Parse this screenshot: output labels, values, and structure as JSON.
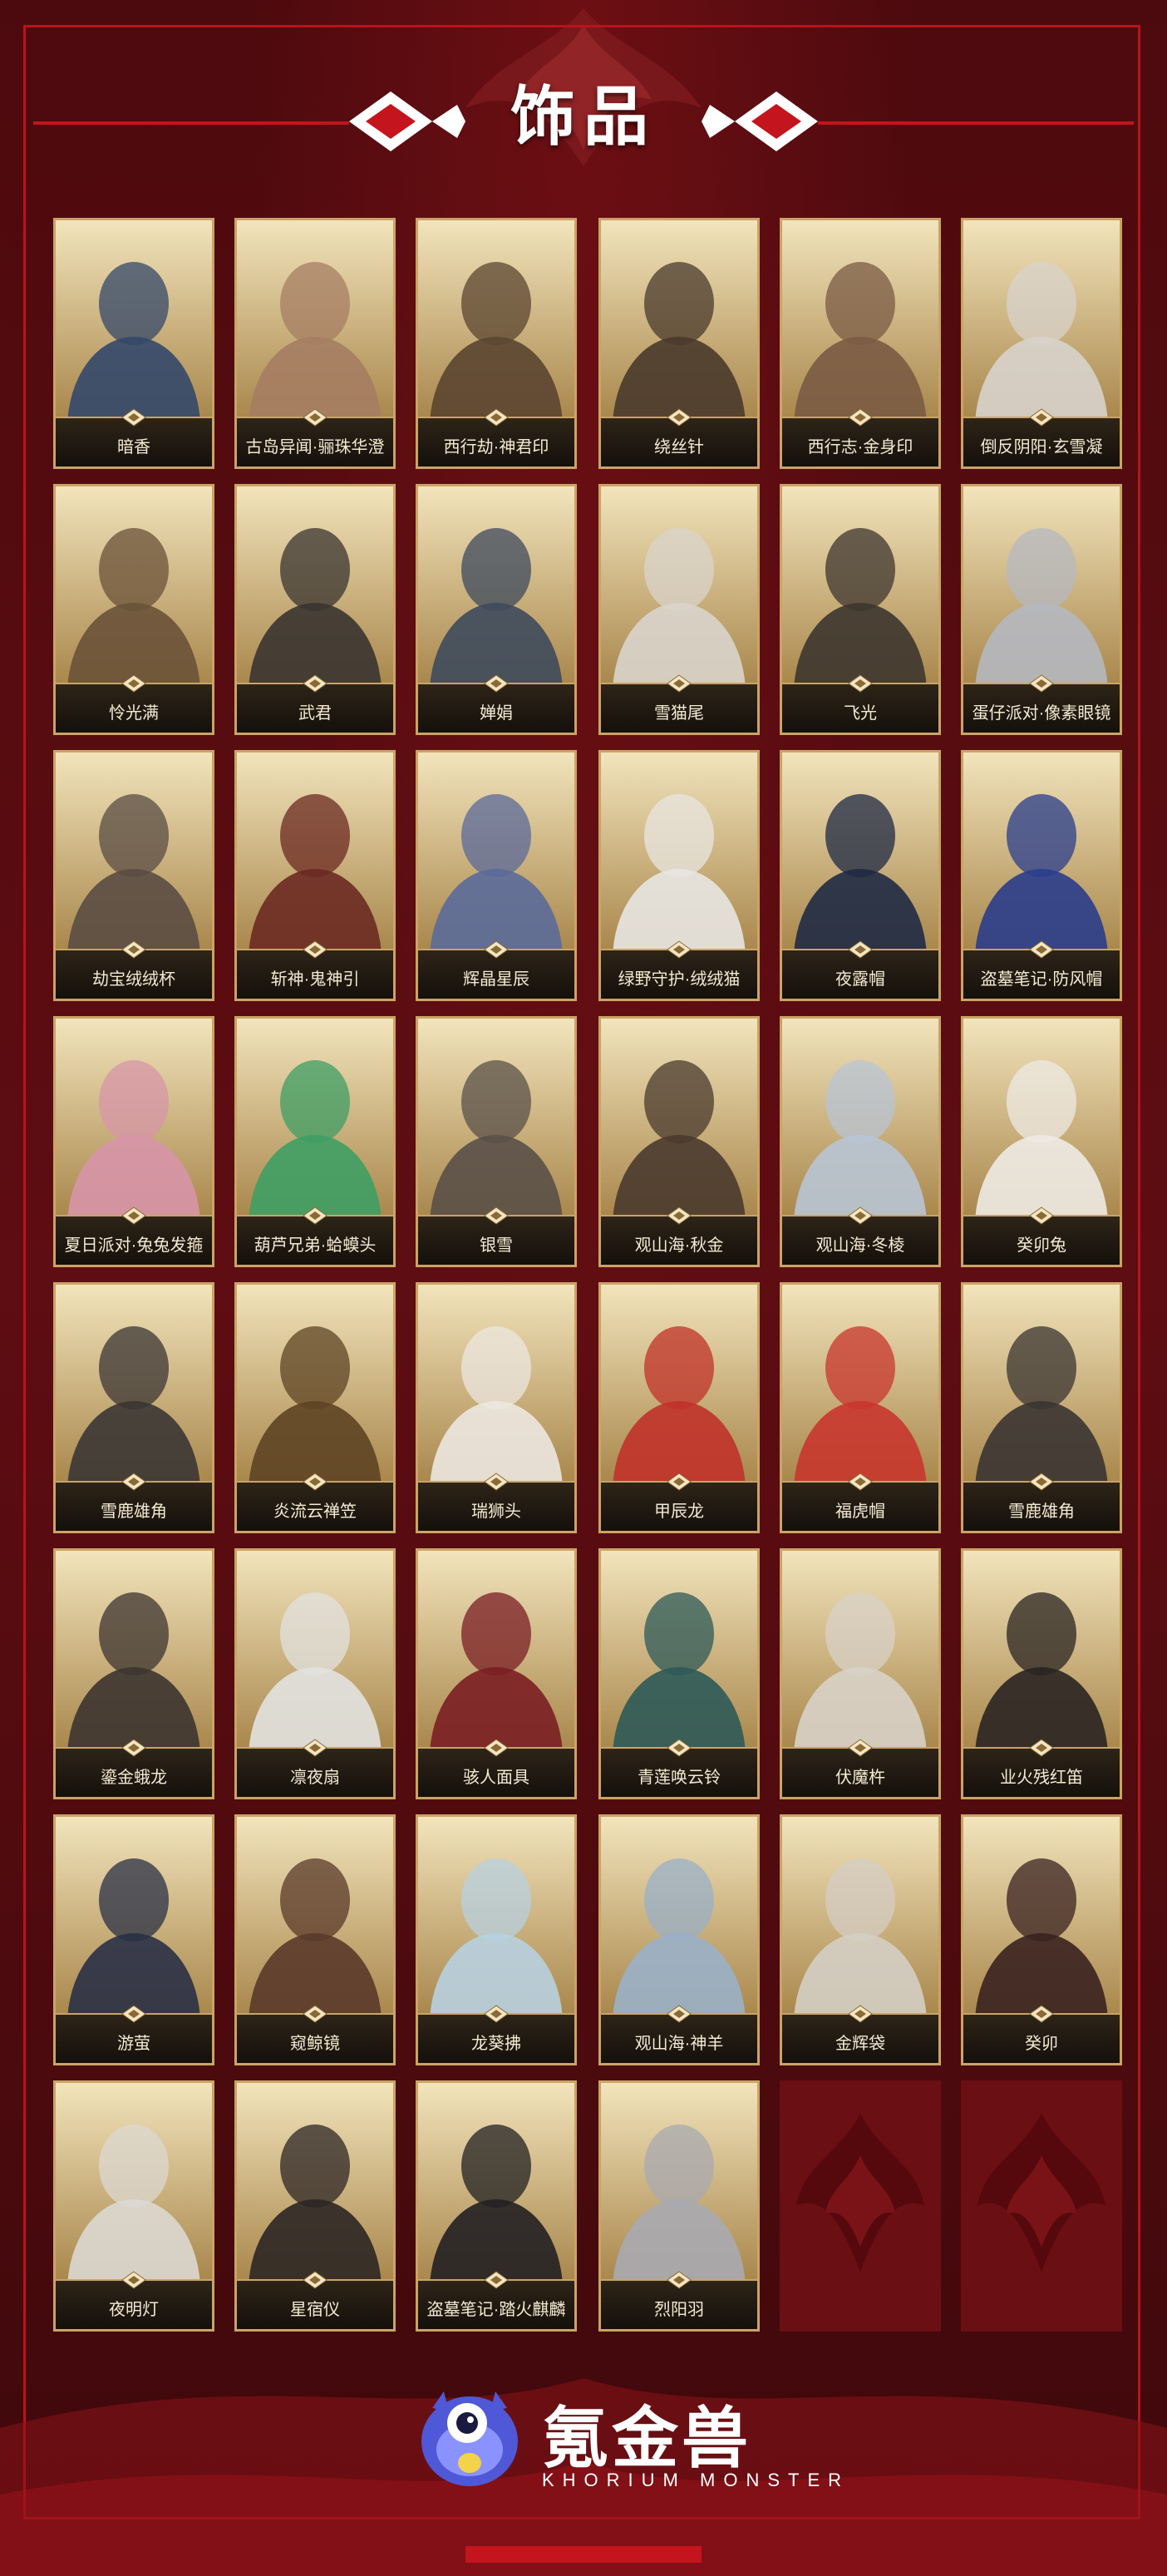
{
  "title": "饰品",
  "brand": {
    "name": "氪金兽",
    "subtitle": "KHORIUM MONSTER"
  },
  "items": [
    {
      "label": "暗香",
      "tone": "#34486a"
    },
    {
      "label": "古岛异闻·骊珠华澄",
      "tone": "#a57d63"
    },
    {
      "label": "西行劫·神君印",
      "tone": "#5b4530"
    },
    {
      "label": "绕丝针",
      "tone": "#4a3a2c"
    },
    {
      "label": "西行志·金身印",
      "tone": "#7a5b44"
    },
    {
      "label": "倒反阴阳·玄雪凝",
      "tone": "#d8d3cc"
    },
    {
      "label": "怜光满",
      "tone": "#6a5238"
    },
    {
      "label": "武君",
      "tone": "#3a3430"
    },
    {
      "label": "婵娟",
      "tone": "#3e4a5c"
    },
    {
      "label": "雪猫尾",
      "tone": "#d9d4cc"
    },
    {
      "label": "飞光",
      "tone": "#3d352f"
    },
    {
      "label": "蛋仔派对·像素眼镜",
      "tone": "#b5b8c0"
    },
    {
      "label": "劫宝绒绒杯",
      "tone": "#5a4c44"
    },
    {
      "label": "斩神·鬼神引",
      "tone": "#6b2a22"
    },
    {
      "label": "辉晶星辰",
      "tone": "#5b6a9a"
    },
    {
      "label": "绿野守护·绒绒猫",
      "tone": "#e8e6e2"
    },
    {
      "label": "夜露帽",
      "tone": "#1f2a44"
    },
    {
      "label": "盗墓笔记·防风帽",
      "tone": "#2a3d8c"
    },
    {
      "label": "夏日派对·兔兔发箍",
      "tone": "#d795a8"
    },
    {
      "label": "葫芦兄弟·蛤蟆头",
      "tone": "#3f9e64"
    },
    {
      "label": "银雪",
      "tone": "#5a5048"
    },
    {
      "label": "观山海·秋金",
      "tone": "#4a3a2e"
    },
    {
      "label": "观山海·冬棱",
      "tone": "#b8c4d4"
    },
    {
      "label": "癸卯兔",
      "tone": "#eeeae4"
    },
    {
      "label": "雪鹿雄角",
      "tone": "#3b3634"
    },
    {
      "label": "炎流云禅笠",
      "tone": "#5e4424"
    },
    {
      "label": "瑞狮头",
      "tone": "#ece7e0"
    },
    {
      "label": "甲辰龙",
      "tone": "#c0322a"
    },
    {
      "label": "福虎帽",
      "tone": "#c8362e"
    },
    {
      "label": "雪鹿雄角",
      "tone": "#3a3432"
    },
    {
      "label": "鎏金蛾龙",
      "tone": "#3c3430"
    },
    {
      "label": "凛夜扇",
      "tone": "#e2e2e0"
    },
    {
      "label": "骇人面具",
      "tone": "#7a1e24"
    },
    {
      "label": "青莲唤云铃",
      "tone": "#2d5a58"
    },
    {
      "label": "伏魔杵",
      "tone": "#d8d2c8"
    },
    {
      "label": "业火残红笛",
      "tone": "#2a2422"
    },
    {
      "label": "游萤",
      "tone": "#2a3046"
    },
    {
      "label": "窥鲸镜",
      "tone": "#5a3a2a"
    },
    {
      "label": "龙葵拂",
      "tone": "#b8d0e0"
    },
    {
      "label": "观山海·神羊",
      "tone": "#9ab0c8"
    },
    {
      "label": "金辉袋",
      "tone": "#d4cec4"
    },
    {
      "label": "癸卯",
      "tone": "#3a2220"
    },
    {
      "label": "夜明灯",
      "tone": "#dcd8d2"
    },
    {
      "label": "星宿仪",
      "tone": "#2c2624"
    },
    {
      "label": "盗墓笔记·踏火麒麟",
      "tone": "#222022"
    },
    {
      "label": "烈阳羽",
      "tone": "#a8aab0"
    }
  ]
}
